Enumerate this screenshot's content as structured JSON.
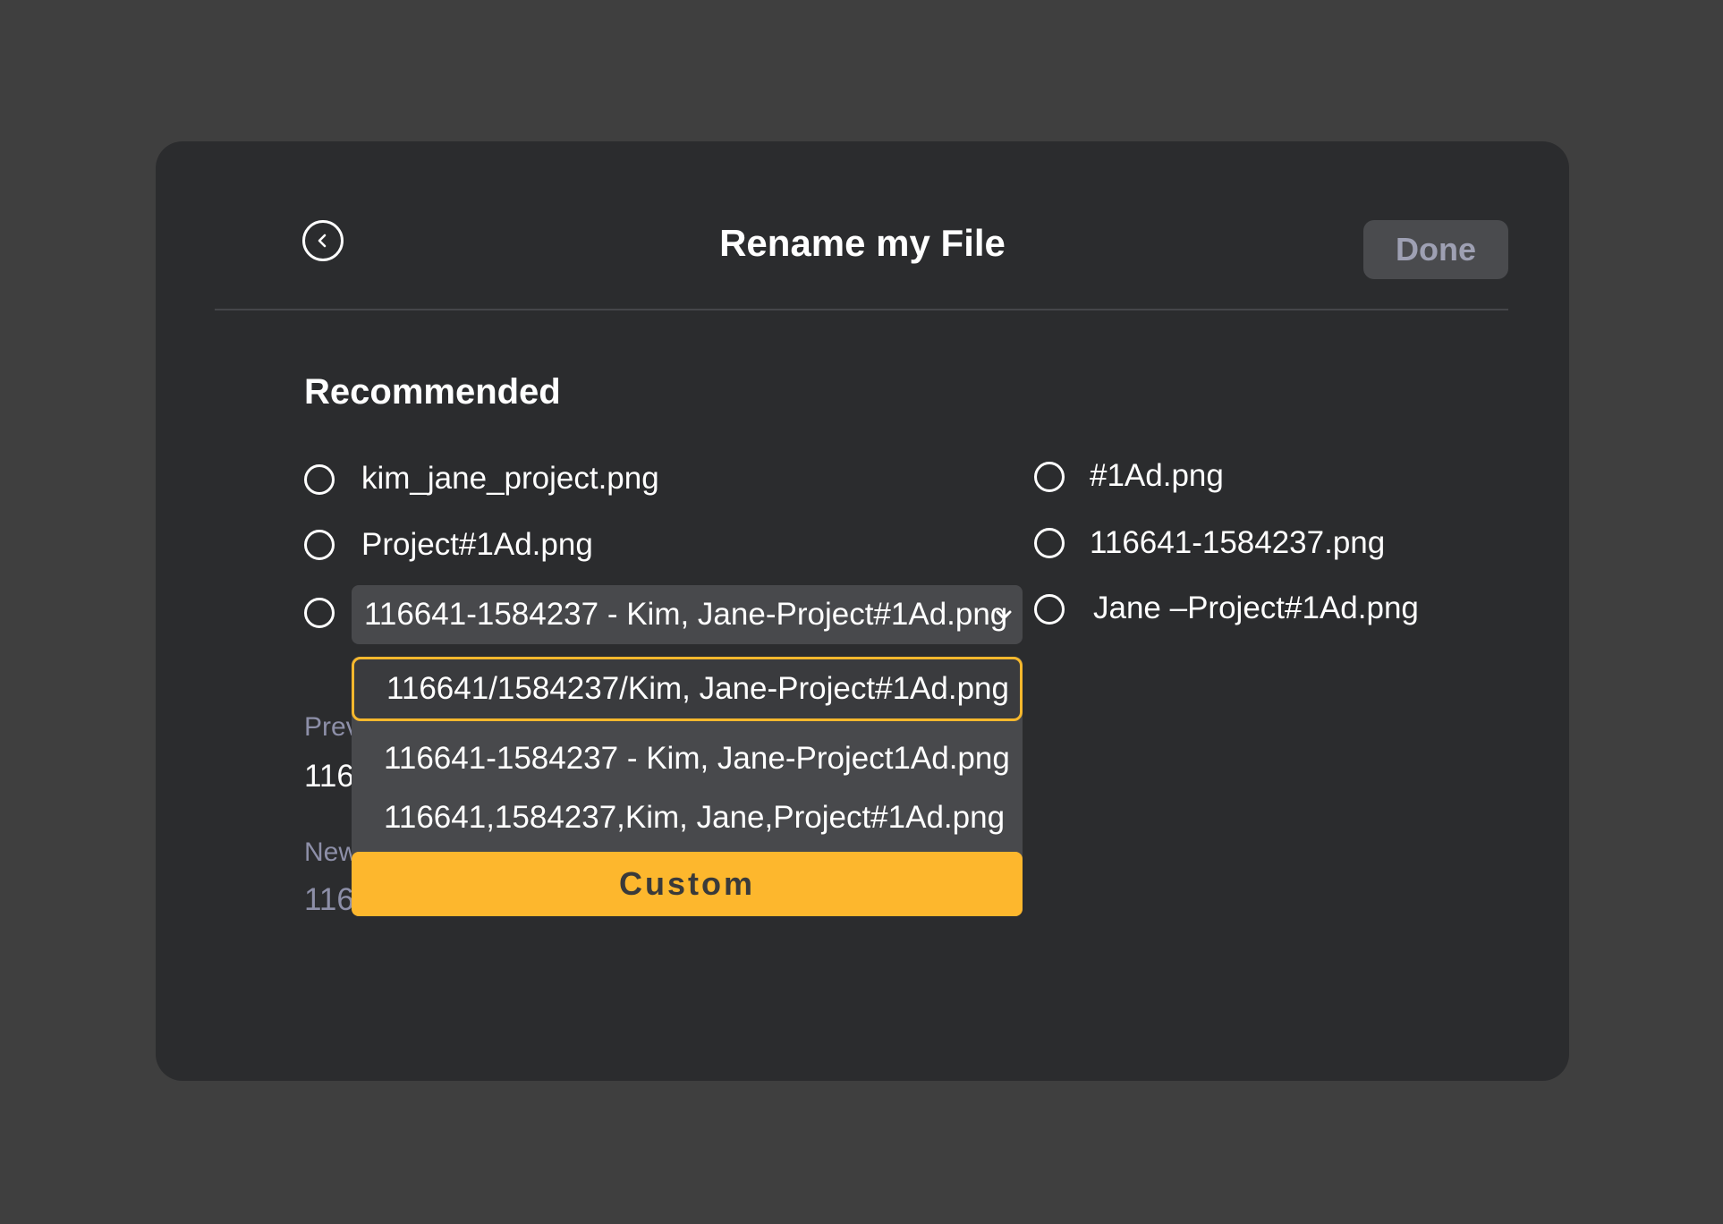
{
  "dialog": {
    "title": "Rename my File",
    "done_label": "Done",
    "back_icon": "chevron-left-icon"
  },
  "recommended": {
    "heading": "Recommended",
    "left_options": [
      {
        "label": "kim_jane_project.png"
      },
      {
        "label": "Project#1Ad.png"
      }
    ],
    "select_value": "116641-1584237 - Kim, Jane-Project#1Ad.png",
    "right_options": [
      {
        "label": "#1Ad.png"
      },
      {
        "label": "116641-1584237.png"
      },
      {
        "label": "Jane –Project#1Ad.png"
      }
    ]
  },
  "behind": {
    "previous_label_visible": "Prev",
    "previous_value_visible": "116",
    "new_label_visible": "New",
    "new_value_visible": "116"
  },
  "dropdown": {
    "options": [
      "116641/1584237/Kim, Jane-Project#1Ad.png",
      "116641-1584237 - Kim, Jane-Project1Ad.png",
      "116641,1584237,Kim, Jane,Project#1Ad.png"
    ],
    "custom_label": "Custom"
  },
  "colors": {
    "background": "#3f3f3f",
    "dialog": "#2b2c2e",
    "accent": "#fdb72d",
    "muted_text": "#8d8fa8"
  }
}
